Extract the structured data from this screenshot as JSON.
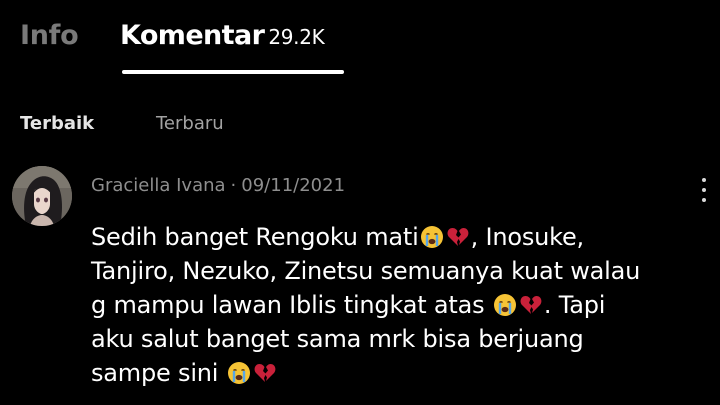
{
  "tabs": {
    "info_label": "Info",
    "komentar_label": "Komentar",
    "komentar_count": "29.2K"
  },
  "sort": {
    "best_label": "Terbaik",
    "new_label": "Terbaru"
  },
  "comment": {
    "author": "Graciella Ivana",
    "separator": "·",
    "date": "09/11/2021",
    "lines": [
      {
        "t1": "Sedih banget Rengoku mati",
        "t2": ", Inosuke,"
      },
      {
        "t1": "Tanjiro, Nezuko, Zinetsu semuanya kuat walau"
      },
      {
        "t1": "g mampu lawan Iblis tingkat atas ",
        "t2": ". Tapi"
      },
      {
        "t1": "aku salut banget sama mrk bisa berjuang"
      },
      {
        "t1": "sampe sini "
      }
    ],
    "emojis": [
      "crying-face",
      "broken-heart"
    ]
  },
  "colors": {
    "background": "#000000",
    "text": "#ffffff",
    "muted": "#8e8e8e",
    "inactive_tab": "#7a7a7a",
    "emoji_yellow": "#f6c335",
    "emoji_tear": "#58a6e8",
    "heart_red": "#c9213a"
  }
}
